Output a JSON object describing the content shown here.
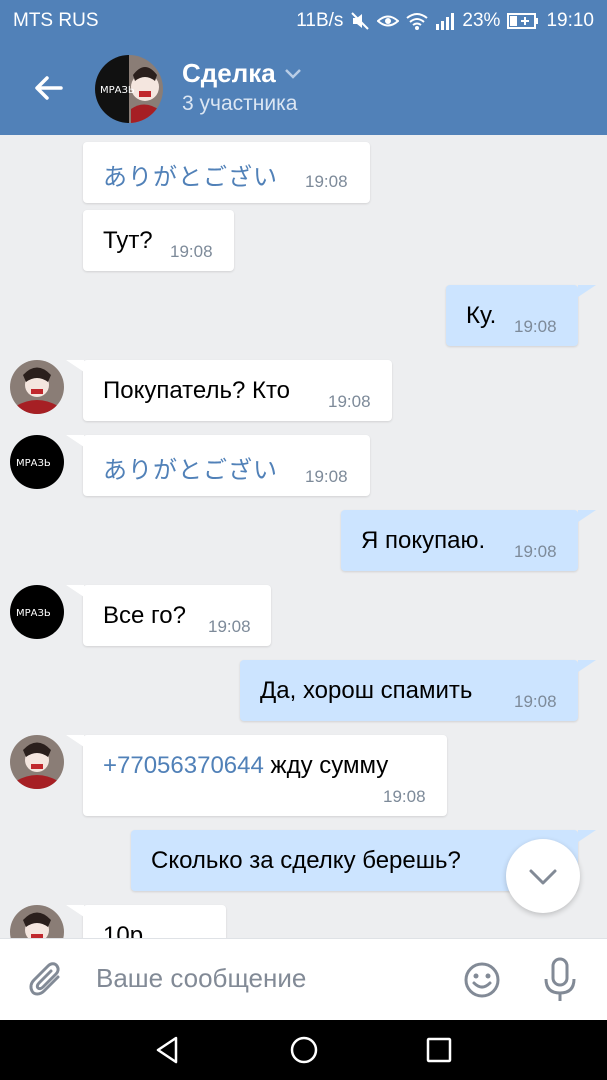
{
  "status_bar": {
    "carrier": "MTS RUS",
    "speed": "11B/s",
    "battery": "23%",
    "time": "19:10",
    "icons": [
      "mute-icon",
      "eye-icon",
      "wifi-icon",
      "signal-icon",
      "battery-icon"
    ]
  },
  "header": {
    "title": "Сделка",
    "subtitle": "3 участника"
  },
  "messages": [
    {
      "direction": "in",
      "text": "ありがとござい",
      "time": "19:08"
    },
    {
      "direction": "in",
      "text": "Тут?",
      "time": "19:08"
    },
    {
      "direction": "out",
      "text": "Ку.",
      "time": "19:08"
    },
    {
      "direction": "in",
      "text": "Покупатель? Кто",
      "time": "19:08"
    },
    {
      "direction": "in",
      "text": "ありがとござい",
      "time": "19:08"
    },
    {
      "direction": "out",
      "text": "Я покупаю.",
      "time": "19:08"
    },
    {
      "direction": "in",
      "text": "Все го?",
      "time": "19:08"
    },
    {
      "direction": "out",
      "text": "Да, хорош спамить",
      "time": "19:08"
    },
    {
      "direction": "in",
      "phone": "+77056370644",
      "text": "жду сумму",
      "time": "19:08"
    },
    {
      "direction": "out",
      "text": "Сколько за сделку берешь?",
      "time": ""
    },
    {
      "direction": "in",
      "text": "10р",
      "time": ""
    }
  ],
  "avatar_text": "МРАЗЬ",
  "composer": {
    "placeholder": "Ваше сообщение"
  },
  "colors": {
    "accent": "#5181b8",
    "outgoing_bubble": "#cce4ff",
    "incoming_bubble": "#ffffff",
    "background": "#edeef0"
  }
}
